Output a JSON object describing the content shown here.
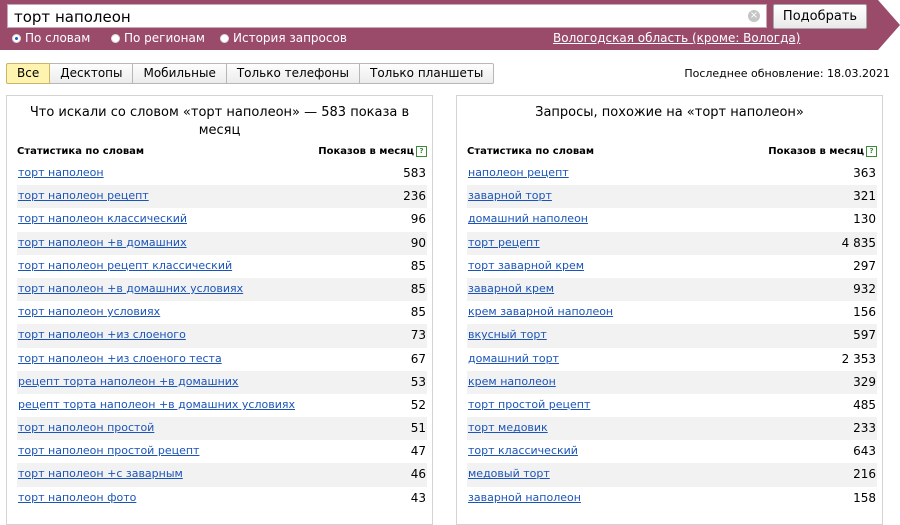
{
  "search": {
    "query": "торт наполеон",
    "submit_label": "Подобрать",
    "clear_symbol": "×"
  },
  "modes": [
    {
      "label": "По словам",
      "selected": true
    },
    {
      "label": "По регионам",
      "selected": false
    },
    {
      "label": "История запросов",
      "selected": false
    }
  ],
  "region_link": "Вологодская область (кроме: Вологда)",
  "device_tabs": [
    {
      "label": "Все",
      "active": true
    },
    {
      "label": "Десктопы",
      "active": false
    },
    {
      "label": "Мобильные",
      "active": false
    },
    {
      "label": "Только телефоны",
      "active": false
    },
    {
      "label": "Только планшеты",
      "active": false
    }
  ],
  "last_update": "Последнее обновление: 18.03.2021",
  "colors": {
    "band": "#9a4b6a",
    "link": "#1b54b8",
    "active_tab": "#fff3b0"
  },
  "left_panel": {
    "title": "Что искали со словом «торт наполеон» — 583 показа в месяц",
    "col_word": "Статистика по словам",
    "col_count": "Показов в месяц",
    "help": "?",
    "rows": [
      {
        "kw": "торт наполеон",
        "count": "583"
      },
      {
        "kw": "торт наполеон рецепт",
        "count": "236"
      },
      {
        "kw": "торт наполеон классический",
        "count": "96"
      },
      {
        "kw": "торт наполеон +в домашних",
        "count": "90"
      },
      {
        "kw": "торт наполеон рецепт классический",
        "count": "85"
      },
      {
        "kw": "торт наполеон +в домашних условиях",
        "count": "85"
      },
      {
        "kw": "торт наполеон условиях",
        "count": "85"
      },
      {
        "kw": "торт наполеон +из слоеного",
        "count": "73"
      },
      {
        "kw": "торт наполеон +из слоеного теста",
        "count": "67"
      },
      {
        "kw": "рецепт торта наполеон +в домашних",
        "count": "53"
      },
      {
        "kw": "рецепт торта наполеон +в домашних условиях",
        "count": "52"
      },
      {
        "kw": "торт наполеон простой",
        "count": "51"
      },
      {
        "kw": "торт наполеон простой рецепт",
        "count": "47"
      },
      {
        "kw": "торт наполеон +с заварным",
        "count": "46"
      },
      {
        "kw": "торт наполеон фото",
        "count": "43"
      }
    ]
  },
  "right_panel": {
    "title": "Запросы, похожие на «торт наполеон»",
    "col_word": "Статистика по словам",
    "col_count": "Показов в месяц",
    "help": "?",
    "rows": [
      {
        "kw": "наполеон рецепт",
        "count": "363"
      },
      {
        "kw": "заварной торт",
        "count": "321"
      },
      {
        "kw": "домашний наполеон",
        "count": "130"
      },
      {
        "kw": "торт рецепт",
        "count": "4 835"
      },
      {
        "kw": "торт заварной крем",
        "count": "297"
      },
      {
        "kw": "заварной крем",
        "count": "932"
      },
      {
        "kw": "крем заварной наполеон",
        "count": "156"
      },
      {
        "kw": "вкусный торт",
        "count": "597"
      },
      {
        "kw": "домашний торт",
        "count": "2 353"
      },
      {
        "kw": "крем наполеон",
        "count": "329"
      },
      {
        "kw": "торт простой рецепт",
        "count": "485"
      },
      {
        "kw": "торт медовик",
        "count": "233"
      },
      {
        "kw": "торт классический",
        "count": "643"
      },
      {
        "kw": "медовый торт",
        "count": "216"
      },
      {
        "kw": "заварной наполеон",
        "count": "158"
      }
    ]
  }
}
